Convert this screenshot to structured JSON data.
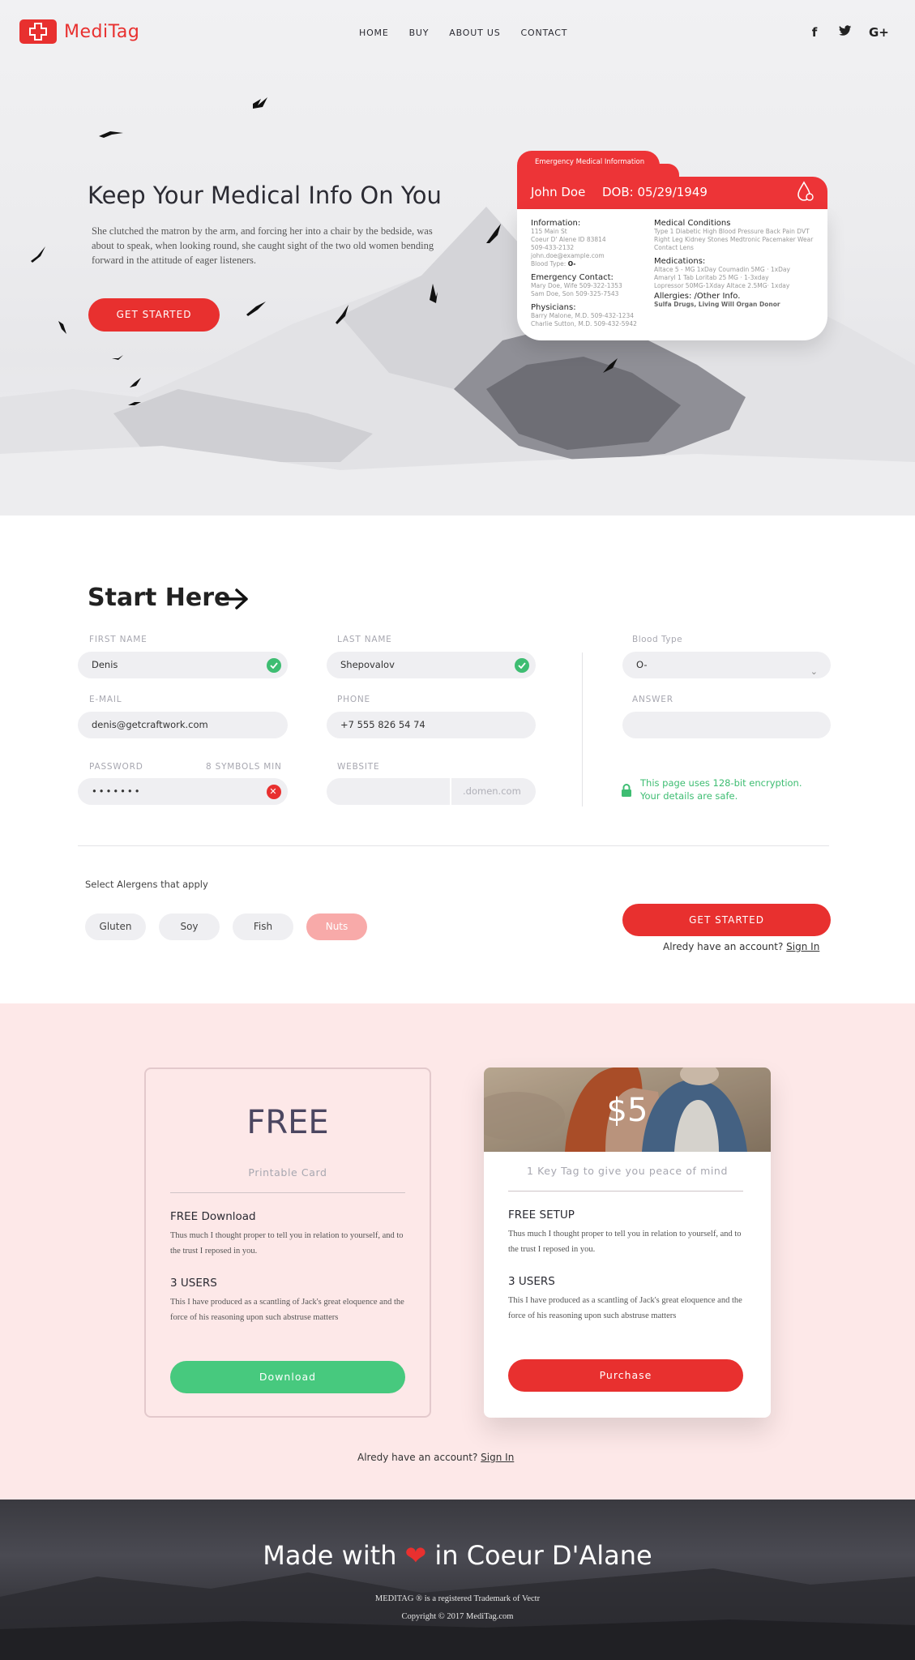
{
  "brand": {
    "name": "MediTag",
    "color": "#e8302f"
  },
  "nav": {
    "items": [
      "HOME",
      "BUY",
      "ABOUT US",
      "CONTACT"
    ]
  },
  "social": [
    {
      "icon": "facebook-icon",
      "glyph": "f"
    },
    {
      "icon": "twitter-icon",
      "glyph": "𝕥"
    },
    {
      "icon": "google-plus-icon",
      "glyph": "G+"
    }
  ],
  "hero": {
    "title": "Keep Your Medical Info On You",
    "copy": "She clutched the matron by the arm, and forcing her into a chair by the bedside, was about to speak, when looking round, she caught sight of the two old women bending forward in the attitude of eager listeners.",
    "cta": "GET STARTED"
  },
  "medical_card": {
    "tab": "Emergency Medical Information",
    "name": "John Doe",
    "dob": "DOB: 05/29/1949",
    "info_title": "Information:",
    "info_lines": [
      "115 Main St",
      "Coeur D' Alene ID 83814",
      "509-433-2132",
      "john.doe@example.com"
    ],
    "blood_label": "Blood Type:",
    "blood_value": "O-",
    "emergency_title": "Emergency Contact:",
    "emergency_lines": [
      "Mary Doe, Wife  509-322-1353",
      "Sam Doe, Son  509-325-7543"
    ],
    "physicians_title": "Physicians:",
    "physicians_lines": [
      "Barry Malone, M.D. 509-432-1234",
      "Charlie Sutton, M.D. 509-432-5942"
    ],
    "conditions_title": "Medical Conditions",
    "conditions_text": "Type 1 Diabetic  High Blood Pressure  Back Pain  DVT Right Leg  Kidney Stones  Medtronic Pacemaker  Wear Contact Lens",
    "medications_title": "Medications:",
    "medications_text": "Altace 5 - MG 1xDay  Coumadin 5MG · 1xDay  Amaryl 1 Tab Loritab 25 MG · 1-3xday  Lopressor 50MG-1Xday  Altace 2.5MG· 1xday",
    "allergies_title": "Allergies: /Other Info.",
    "allergies_text": "Sulfa Drugs,  Living Will  Organ Donor"
  },
  "form": {
    "title": "Start Here",
    "first_name": {
      "label": "FIRST NAME",
      "value": "Denis"
    },
    "last_name": {
      "label": "LAST NAME",
      "value": "Shepovalov"
    },
    "email": {
      "label": "E-MAIL",
      "value": "denis@getcraftwork.com"
    },
    "phone": {
      "label": "PHONE",
      "value": "+7 555 826 54 74"
    },
    "password": {
      "label": "PASSWORD",
      "hint": "8 SYMBOLS MIN",
      "value": "•••••••"
    },
    "website": {
      "label": "WEBSITE",
      "suffix": ".domen.com"
    },
    "blood_type": {
      "label": "Blood Type",
      "value": "O-"
    },
    "answer": {
      "label": "ANSWER",
      "value": ""
    },
    "security_line1": "This page uses 128-bit encryption.",
    "security_line2": "Your details are safe.",
    "allergens_label": "Select Alergens that apply",
    "allergens": [
      "Gluten",
      "Soy",
      "Fish",
      "Nuts"
    ],
    "cta": "GET STARTED",
    "account_text": "Alredy have an account?",
    "sign_in": "Sign In"
  },
  "pricing": {
    "free": {
      "price": "FREE",
      "subtitle": "Printable Card",
      "h1": "FREE Download",
      "t1": "Thus much I thought proper to tell you in relation to yourself, and to the trust I reposed in you.",
      "h2": "3 USERS",
      "t2": "This I have produced as a scantling of Jack's great eloquence and the force of his reasoning upon such abstruse matters",
      "button": "Download"
    },
    "paid": {
      "price": "$5",
      "subtitle": "1 Key Tag to give you peace of mind",
      "h1": "FREE SETUP",
      "t1": "Thus much I thought proper to tell you in relation to yourself, and to the trust I reposed in you.",
      "h2": "3 USERS",
      "t2": "This I have produced as a scantling of Jack's great eloquence and the force of his reasoning upon such abstruse matters",
      "button": "Purchase"
    },
    "account_text": "Alredy have an account?",
    "sign_in": "Sign In"
  },
  "footer": {
    "made_pre": "Made with",
    "made_post": "in Coeur D'Alane",
    "trademark": "MEDITAG ® is a registered Trademark of  Vectr",
    "copyright": "Copyright © 2017 MediTag.com"
  },
  "colors": {
    "accent": "#e8302f",
    "success": "#3ebd72",
    "pink_bg": "#fde8e8",
    "nuts_chip": "#f8aaa9"
  }
}
